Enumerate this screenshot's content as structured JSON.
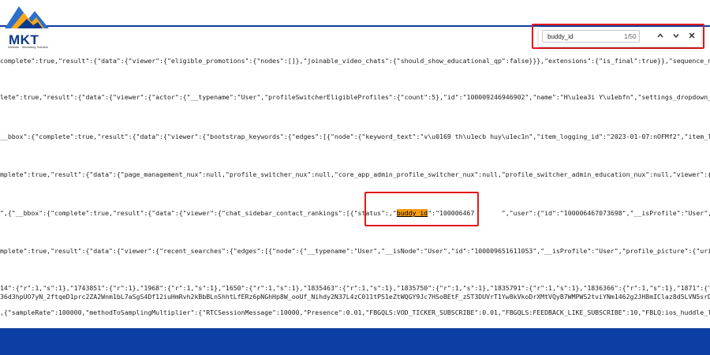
{
  "logo": {
    "text": "MKT",
    "subtext": "Website · Marketing Solution"
  },
  "find_bar": {
    "query": "buddy_id",
    "count": "1/50",
    "prev_icon": "chevron-up",
    "next_icon": "chevron-down",
    "close_icon": "close"
  },
  "lines": [
    {
      "text": "complete\":true,\"result\":{\"data\":{\"viewer\":{\"eligible_promotions\":{\"nodes\":[]},\"joinable_video_chats\":{\"should_show_educational_qp\":false}}},\"extensions\":{\"is_final\":true}},\"sequence_number\":0,\"va"
    },
    {
      "text": "lete\":true,\"result\":{\"data\":{\"viewer\":{\"actor\":{\"__typename\":\"User\",\"profileSwitcherEligibleProfiles\":{\"count\":5},\"id\":\"100009246946902\",\"name\":\"H\\u1ea3i Y\\u1ebfn\",\"settings_dropdown_profile_pict"
    },
    {
      "text": "__bbox\":{\"complete\":true,\"result\":{\"data\":{\"viewer\":{\"bootstrap_keywords\":{\"edges\":[{\"node\":{\"keyword_text\":\"v\\u0169 th\\u1ecb huy\\u1ec1n\",\"item_logging_id\":\"2023-01-07:nOFMf2\",\"item_logging_info\""
    },
    {
      "text": "mplete\":true,\"result\":{\"data\":{\"page_management_nux\":null,\"profile_switcher_nux\":null,\"core_app_admin_profile_switcher_nux\":null,\"profile_switcher_admin_education_nux\":null,\"viewer\":{\"actor\":{\"__"
    },
    {
      "pre": "\",{\"__bbox\":{\"complete\":true,\"result\":{\"data\":{\"viewer\":{\"chat_sidebar_contact_rankings\":[{\"status\":,\"",
      "hl": "buddy_id",
      "post": "\":\"100006467       \",\"user\":{\"id\":\"100006467073698\",\"__isProfile\":\"User\",\"name\":\"L\\u0"
    },
    {
      "text": "mplete\":true,\"result\":{\"data\":{\"viewer\":{\"recent_searches\":{\"edges\":[{\"node\":{\"__typename\":\"User\",\"__isNode\":\"User\",\"id\":\"100009651611053\",\"__isProfile\":\"User\",\"profile_picture\":{\"uri\":\"https:\\/\\"
    },
    {
      "text": "14\":{\"r\":1,\"s\":1},\"1743851\":{\"r\":1},\"1968\":{\"r\":1,\"s\":1},\"1650\":{\"r\":1,\"s\":1},\"1835463\":{\"r\":1,\"s\":1},\"1835750\":{\"r\":1,\"s\":1},\"1835791\":{\"r\":1,\"s\":1},\"1836366\":{\"r\":1,\"s\":1},\"1871\":{\"r\":1,\"s\":1},"
    },
    {
      "text": "36d3hpUO7yN_2ftqeD1prc2ZA2Wnm1bL7aSgS4Df12iuHmRvh2kBbBLnShhtLfERz6pNGhHp8W_ooUf_Nihdy2N37L4zC011tPS1eZtWQGY9Jc7HSoBEtF_zST3DUVrT1Yw8kVkoDrXMtVQyB7WMPWS2tviYNm1462g2JH8mIClaz8d5LVN5srDNSNxo-Bh0-vb"
    },
    {
      "text": ",{\"sampleRate\":100000,\"methodToSamplingMultiplier\":{\"RTCSessionMessage\":10000,\"Presence\":0.01,\"FBGQLS:VOD_TICKER_SUBSCRIBE\":0.01,\"FBGQLS:FEEDBACK_LIKE_SUBSCRIBE\":10,\"FBLQ:ios_huddle_listener\":100"
    }
  ]
}
